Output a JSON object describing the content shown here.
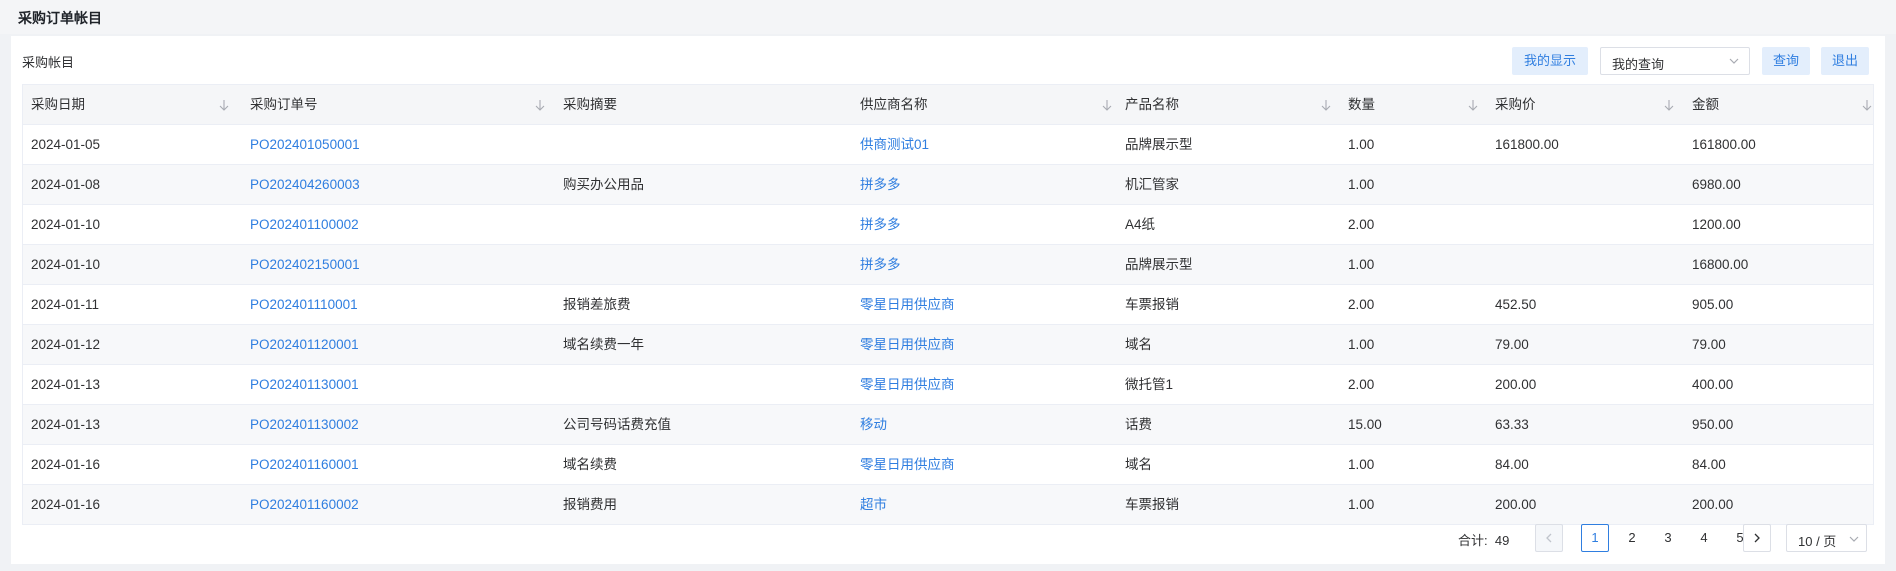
{
  "page_title": "采购订单帐目",
  "panel_title": "采购帐目",
  "toolbar": {
    "my_display_label": "我的显示",
    "my_query_value": "我的查询",
    "query_label": "查询",
    "exit_label": "退出"
  },
  "table": {
    "columns": [
      "采购日期",
      "采购订单号",
      "采购摘要",
      "供应商名称",
      "产品名称",
      "数量",
      "采购价",
      "金额"
    ],
    "rows": [
      [
        "2024-01-05",
        "PO202401050001",
        "",
        "供商测试01",
        "品牌展示型",
        "1.00",
        "161800.00",
        "161800.00"
      ],
      [
        "2024-01-08",
        "PO202404260003",
        "购买办公用品",
        "拼多多",
        "机汇管家",
        "1.00",
        "",
        "6980.00"
      ],
      [
        "2024-01-10",
        "PO202401100002",
        "",
        "拼多多",
        "A4纸",
        "2.00",
        "",
        "1200.00"
      ],
      [
        "2024-01-10",
        "PO202402150001",
        "",
        "拼多多",
        "品牌展示型",
        "1.00",
        "",
        "16800.00"
      ],
      [
        "2024-01-11",
        "PO202401110001",
        "报销差旅费",
        "零星日用供应商",
        "车票报销",
        "2.00",
        "452.50",
        "905.00"
      ],
      [
        "2024-01-12",
        "PO202401120001",
        "域名续费一年",
        "零星日用供应商",
        "域名",
        "1.00",
        "79.00",
        "79.00"
      ],
      [
        "2024-01-13",
        "PO202401130001",
        "",
        "零星日用供应商",
        "微托管1",
        "2.00",
        "200.00",
        "400.00"
      ],
      [
        "2024-01-13",
        "PO202401130002",
        "公司号码话费充值",
        "移动",
        "话费",
        "15.00",
        "63.33",
        "950.00"
      ],
      [
        "2024-01-16",
        "PO202401160001",
        "域名续费",
        "零星日用供应商",
        "域名",
        "1.00",
        "84.00",
        "84.00"
      ],
      [
        "2024-01-16",
        "PO202401160002",
        "报销费用",
        "超市",
        "车票报销",
        "1.00",
        "200.00",
        "200.00"
      ]
    ]
  },
  "pagination": {
    "total_label": "合计:",
    "total": "49",
    "pages": [
      "1",
      "2",
      "3",
      "4",
      "5"
    ],
    "current": "1",
    "prev_icon": "chevron-left-icon",
    "next_icon": "chevron-right-icon",
    "page_size": "10 / 页"
  },
  "colors": {
    "accent": "#2f7ee0",
    "button_bg": "#e3eefc",
    "header_bg": "#f5f6f8",
    "stripe_bg": "#f7f8fa"
  }
}
